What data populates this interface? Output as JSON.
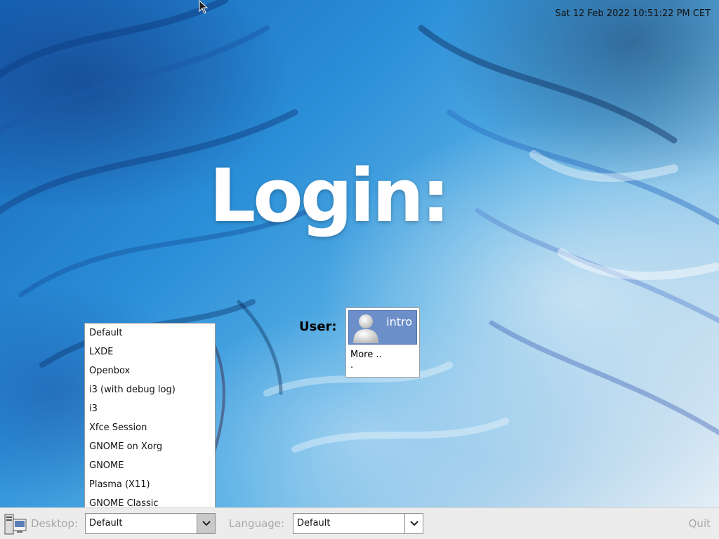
{
  "clock": {
    "text": "Sat 12 Feb 2022 10:51:22 PM CET"
  },
  "login": {
    "title": "Login:"
  },
  "user_select": {
    "label": "User:",
    "users": [
      {
        "name": "intro",
        "icon": "user-avatar-icon"
      }
    ],
    "more_label": "More ..",
    "extra": "."
  },
  "desktop_dropdown": {
    "options": [
      "Default",
      "LXDE",
      "Openbox",
      "i3 (with debug log)",
      "i3",
      "Xfce Session",
      "GNOME on Xorg",
      "GNOME",
      "Plasma (X11)",
      "GNOME Classic"
    ]
  },
  "bottom_bar": {
    "session_icon": "session-icon",
    "desktop_label": "Desktop:",
    "desktop_value": "Default",
    "language_label": "Language:",
    "language_value": "Default",
    "quit_label": "Quit"
  },
  "colors": {
    "user_tile": "#6c8fc9",
    "bar_background": "#ececec",
    "disabled_text": "#a8a8a8"
  }
}
